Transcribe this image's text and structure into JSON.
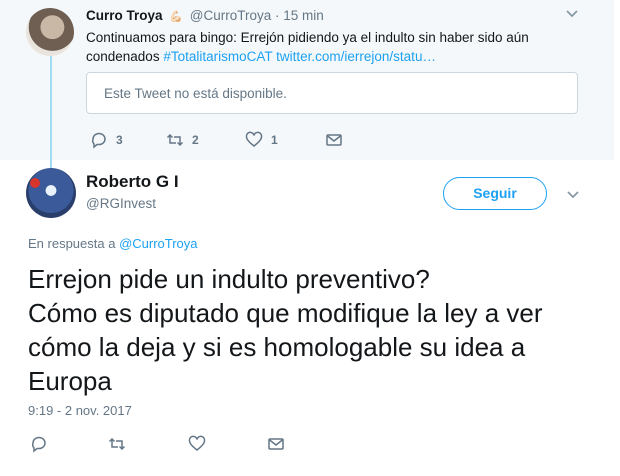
{
  "parent_tweet": {
    "name": "Curro Troya",
    "emoji": "💪🏻",
    "handle": "@CurroTroya",
    "separator": "·",
    "time": "15 min",
    "text_plain": "Continuamos para bingo: Errejón pidiendo ya el indulto sin haber sido aún condenados ",
    "hashtag": "#TotalitarismoCAT",
    "link": "twitter.com/ierrejon/statu…",
    "quoted_unavailable": "Este Tweet no está disponible.",
    "reply_count": "3",
    "retweet_count": "2",
    "like_count": "1"
  },
  "main_tweet": {
    "name": "Roberto G I",
    "handle": "@RGInvest",
    "follow_label": "Seguir",
    "reply_prefix": "En respuesta a ",
    "reply_to_handle": "@CurroTroya",
    "text": "Errejon pide un indulto preventivo?\nCómo es diputado que modifique la ley a ver cómo la deja y si es homologable su idea a Europa",
    "timestamp": "9:19 - 2 nov. 2017"
  },
  "colors": {
    "accent": "#1da1f2",
    "muted": "#657786",
    "parent_bg": "#f5f8fa",
    "thread_line": "#9fdcf3"
  },
  "icons": [
    "reply-icon",
    "retweet-icon",
    "like-icon",
    "message-icon",
    "chevron-down-icon"
  ]
}
